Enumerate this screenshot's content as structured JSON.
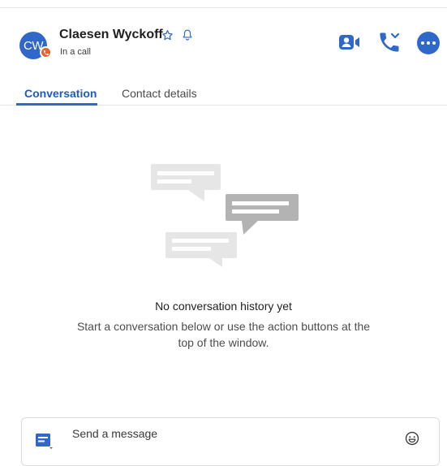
{
  "contact": {
    "initials": "CW",
    "name": "Claesen Wyckoff",
    "status": "In a call"
  },
  "header_icons": {
    "favorite": "star-outline-icon",
    "notifications": "bell-outline-icon",
    "video": "video-camera-icon",
    "phone": "phone-dropdown-icon",
    "more": "more-options-icon"
  },
  "tabs": [
    {
      "label": "Conversation",
      "active": true
    },
    {
      "label": "Contact details",
      "active": false
    }
  ],
  "empty_state": {
    "title": "No conversation history yet",
    "description": "Start a conversation below or use the action buttons at the top of the window."
  },
  "composer": {
    "placeholder": "Send a message",
    "left_icon": "message-template-icon",
    "right_icon": "emoji-icon"
  },
  "colors": {
    "accent": "#2f68c8",
    "status_badge": "#e8642c",
    "bubble_light": "#e6e6e6",
    "bubble_dark": "#b3b3b3"
  }
}
